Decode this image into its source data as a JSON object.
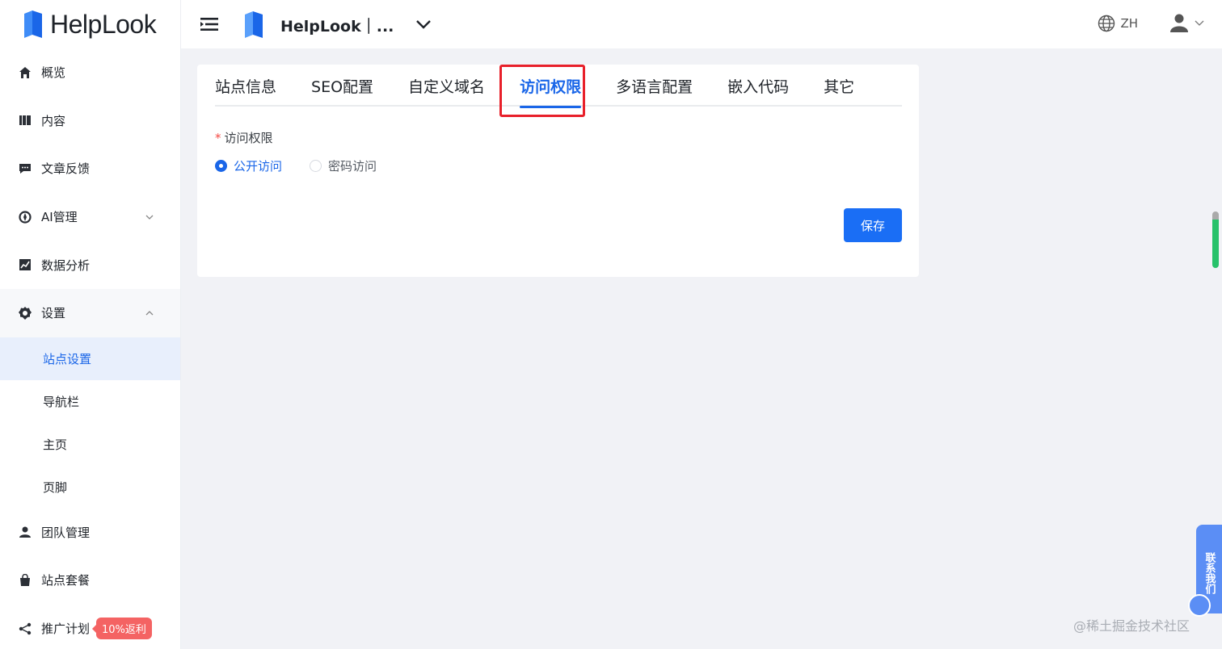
{
  "brand": {
    "name": "HelpLook"
  },
  "header": {
    "site_name": "HelpLook｜...",
    "language": "ZH"
  },
  "sidebar": {
    "items": [
      {
        "label": "概览",
        "icon": "home-icon"
      },
      {
        "label": "内容",
        "icon": "book-icon"
      },
      {
        "label": "文章反馈",
        "icon": "message-icon"
      },
      {
        "label": "AI管理",
        "icon": "ai-icon"
      },
      {
        "label": "数据分析",
        "icon": "chart-icon"
      },
      {
        "label": "设置",
        "icon": "gear-icon"
      }
    ],
    "settings_children": [
      "站点设置",
      "导航栏",
      "主页",
      "页脚"
    ],
    "bottom_items": [
      {
        "label": "团队管理",
        "icon": "user-icon"
      },
      {
        "label": "站点套餐",
        "icon": "bag-icon"
      },
      {
        "label": "推广计划",
        "icon": "share-icon",
        "badge": "10%返利"
      }
    ]
  },
  "tabs": [
    "站点信息",
    "SEO配置",
    "自定义域名",
    "访问权限",
    "多语言配置",
    "嵌入代码",
    "其它"
  ],
  "form": {
    "required_mark": "*",
    "label": "访问权限",
    "options": [
      "公开访问",
      "密码访问"
    ],
    "save_label": "保存"
  },
  "contact": "联系我们",
  "watermark": "@稀土掘金技术社区",
  "colors": {
    "accent": "#1a66e8",
    "highlight": "#e8202a",
    "badge": "#f46363"
  }
}
